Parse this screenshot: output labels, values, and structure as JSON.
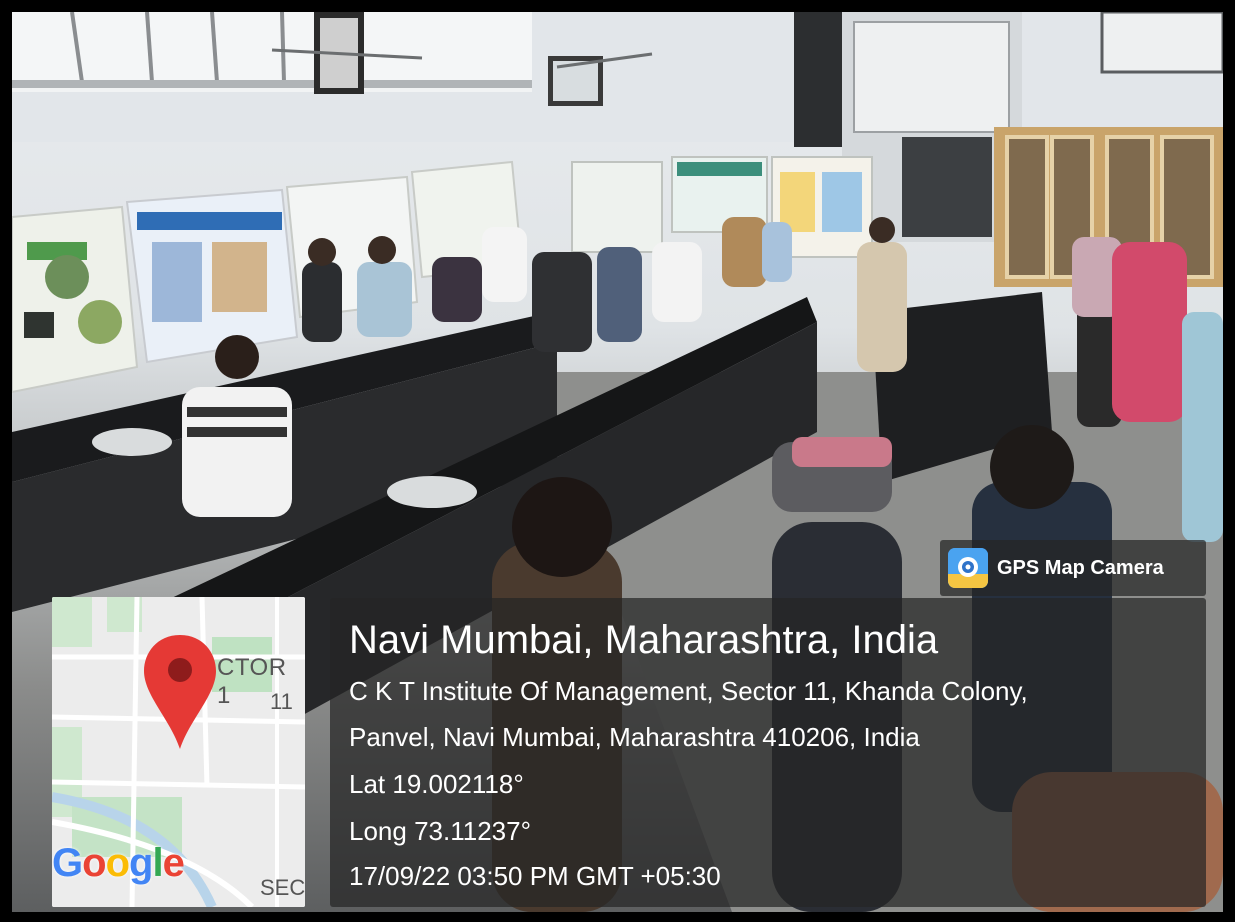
{
  "overlay": {
    "badge": {
      "label": "GPS Map Camera",
      "icon": "gps-map-camera-icon"
    },
    "location": {
      "title": "Navi Mumbai, Maharashtra, India",
      "address_line_1": "C K T Institute Of Management, Sector 11, Khanda Colony,",
      "address_line_2": "Panvel, Navi Mumbai, Maharashtra 410206, India",
      "latitude": "Lat 19.002118°",
      "longitude": "Long 73.11237°",
      "datetime": "17/09/22 03:50 PM GMT +05:30"
    },
    "map": {
      "label_sector": "CTOR 1",
      "label_number": "11",
      "label_bottom": "SEC",
      "logo_letters": [
        "G",
        "o",
        "o",
        "g",
        "l",
        "e"
      ],
      "logo_colors": [
        "#4285F4",
        "#EA4335",
        "#FBBC05",
        "#4285F4",
        "#34A853",
        "#EA4335"
      ],
      "pin_color": "#E53935"
    }
  }
}
